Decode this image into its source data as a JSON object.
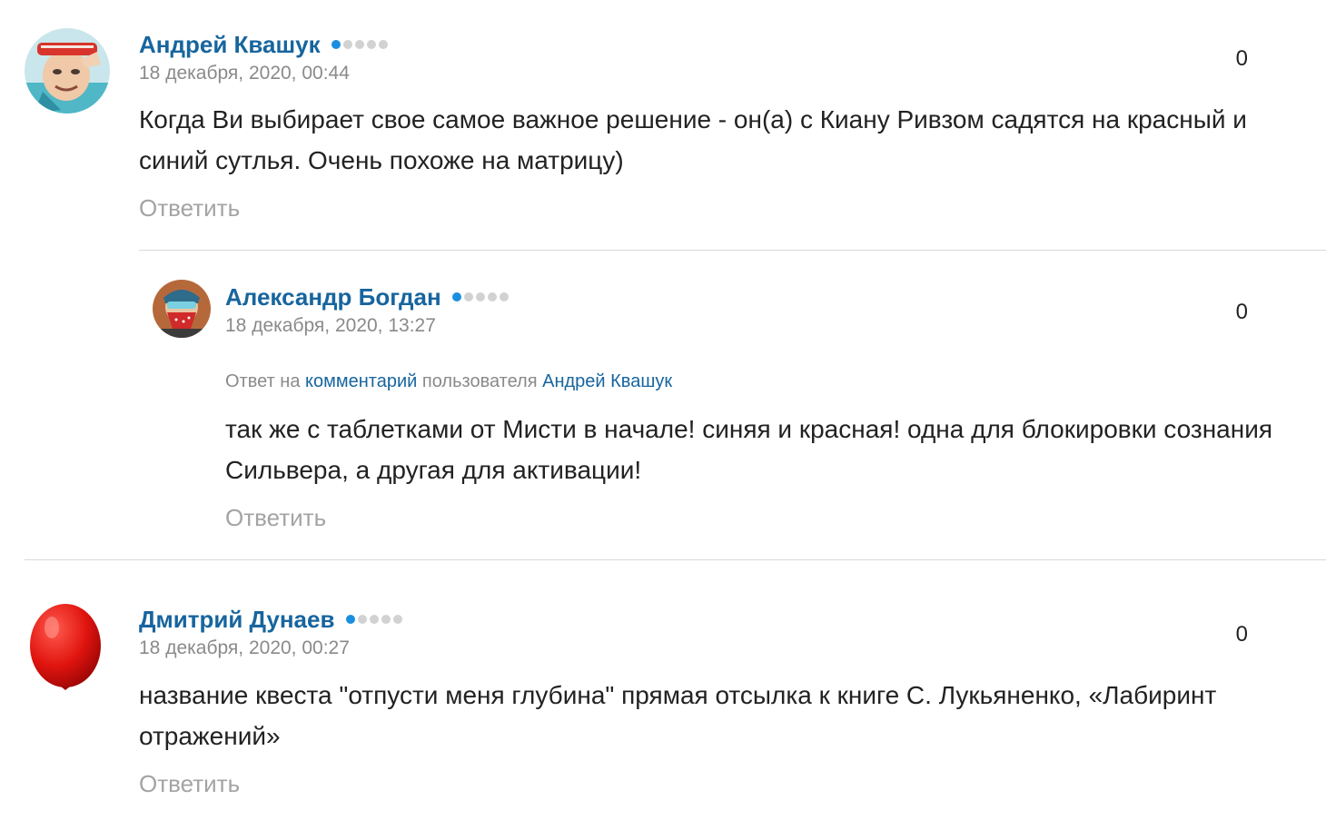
{
  "comments": [
    {
      "author": "Андрей Квашук",
      "date": "18 декабря, 2020, 00:44",
      "score": "0",
      "text": "Когда Ви выбирает свое самое важное решение - он(а) с Киану Ривзом садятся на красный и синий сутлья. Очень похоже на матрицу)",
      "reply_label": "Ответить",
      "rank_level": 1
    },
    {
      "author": "Александр Богдан",
      "date": "18 декабря, 2020, 13:27",
      "score": "0",
      "reply_to": {
        "prefix": "Ответ на",
        "link": "комментарий",
        "middle": "пользователя",
        "user": "Андрей Квашук"
      },
      "text": "так же с таблетками от Мисти в начале! синяя и красная! одна для блокировки сознания Сильвера, а другая для активации!",
      "reply_label": "Ответить",
      "rank_level": 1
    },
    {
      "author": "Дмитрий Дунаев",
      "date": "18 декабря, 2020, 00:27",
      "score": "0",
      "text": "название квеста \"отпусти меня глубина\" прямая отсылка к книге С. Лукьяненко, «Лабиринт отражений»",
      "reply_label": "Ответить",
      "rank_level": 1
    }
  ],
  "colors": {
    "author": "#17659e",
    "rank_active": "#1a8fe0",
    "rank_inactive": "#d2d2d2",
    "muted": "#8a8a8a",
    "reply": "#a3a3a3"
  }
}
